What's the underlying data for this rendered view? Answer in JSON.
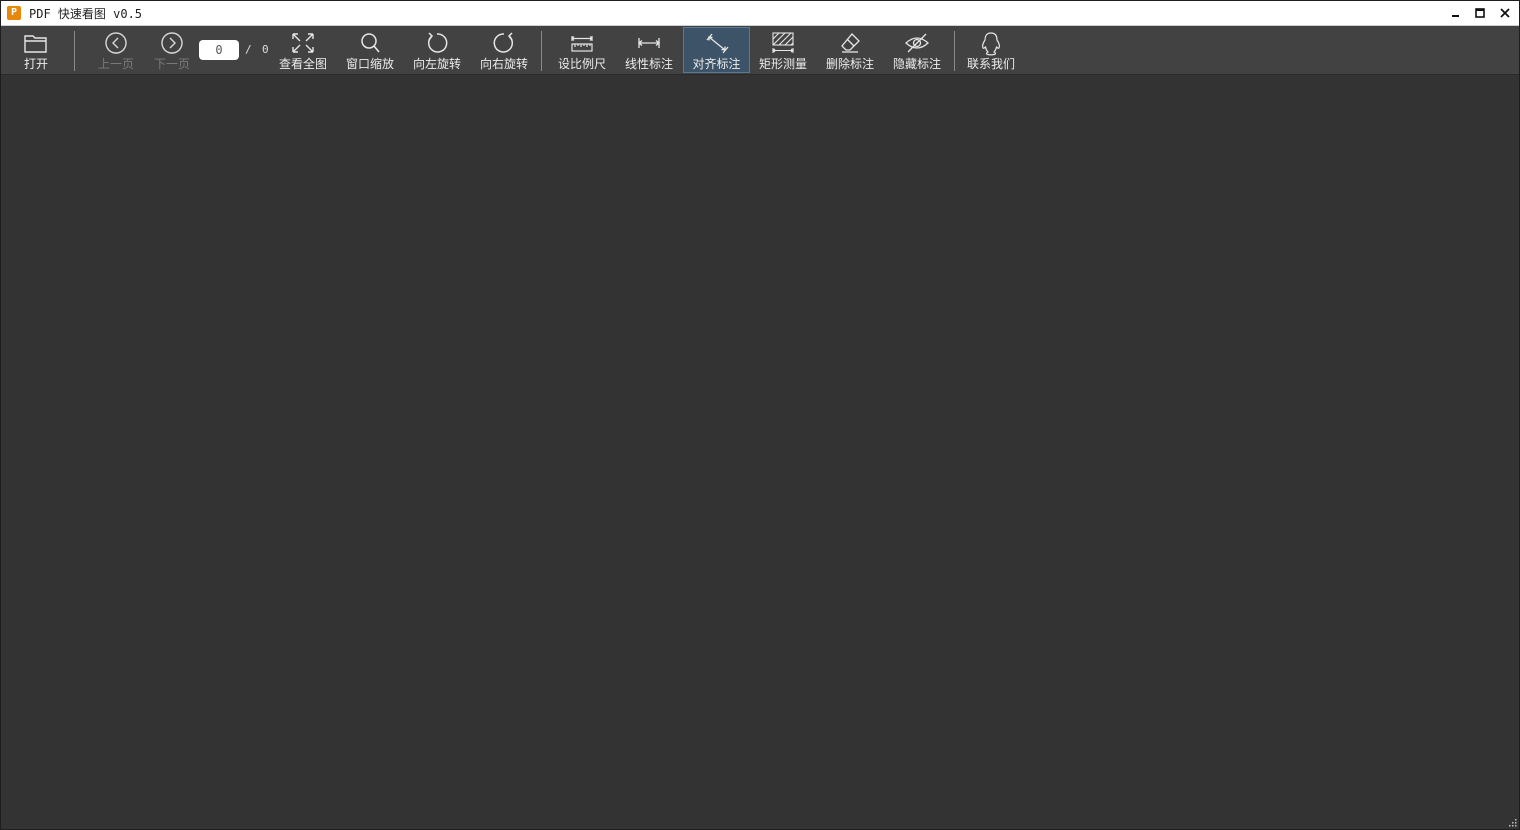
{
  "window": {
    "app_icon_letter": "P",
    "title": "PDF 快速看图 v0.5",
    "controls": {
      "minimize": "minimize-icon",
      "maximize": "maximize-icon",
      "close": "close-icon"
    }
  },
  "toolbar": {
    "open": {
      "label": "打开",
      "icon": "folder-icon"
    },
    "prev_page": {
      "label": "上一页",
      "icon": "chevron-left-circle-icon",
      "enabled": false
    },
    "next_page": {
      "label": "下一页",
      "icon": "chevron-right-circle-icon",
      "enabled": false
    },
    "page": {
      "current": "0",
      "separator": "/",
      "total": "0"
    },
    "fit_all": {
      "label": "查看全图",
      "icon": "expand-icon"
    },
    "window_zoom": {
      "label": "窗口缩放",
      "icon": "magnifier-icon"
    },
    "rotate_left": {
      "label": "向左旋转",
      "icon": "rotate-left-icon"
    },
    "rotate_right": {
      "label": "向右旋转",
      "icon": "rotate-right-icon"
    },
    "set_scale": {
      "label": "设比例尺",
      "icon": "ruler-icon"
    },
    "linear_dim": {
      "label": "线性标注",
      "icon": "linear-dimension-icon"
    },
    "aligned_dim": {
      "label": "对齐标注",
      "icon": "aligned-dimension-icon",
      "active": true
    },
    "rect_measure": {
      "label": "矩形测量",
      "icon": "hatched-rectangle-icon"
    },
    "delete_dim": {
      "label": "删除标注",
      "icon": "eraser-icon"
    },
    "hide_dim": {
      "label": "隐藏标注",
      "icon": "eye-slash-icon"
    },
    "contact": {
      "label": "联系我们",
      "icon": "qq-penguin-icon"
    }
  },
  "colors": {
    "background": "#333333",
    "toolbar": "#424242",
    "active_tool": "#3d5367",
    "app_icon": "#e8880a"
  }
}
